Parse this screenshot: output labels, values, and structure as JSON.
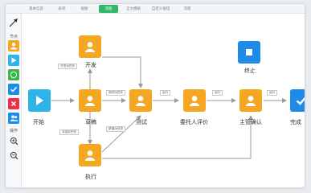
{
  "tabs": [
    "基本信息",
    "表单",
    "视图",
    "流程",
    "正文模板",
    "自定义按钮",
    "流程"
  ],
  "active_tab_index": 3,
  "sidebar": {
    "nodes_label": "节点",
    "ops_label": "操作",
    "tools": [
      "arrow-icon",
      "person-icon",
      "play-icon",
      "wechat-icon",
      "check-icon",
      "close-icon",
      "group-icon",
      "zoom-in-icon",
      "zoom-out-icon"
    ]
  },
  "nodes": {
    "start": "开始",
    "kaifa": "开发",
    "draft": "草稿",
    "test": "测试",
    "exec": "执行",
    "entrust": "委托人评价",
    "manager": "主管确认",
    "end": "终止",
    "complete": "完成"
  },
  "edge_labels": {
    "to_dev": "开发派任务",
    "to_test": "调试派任务",
    "to_exec": "新增派任务",
    "assign": "派给执任务",
    "pass1": "运行",
    "pass2": "运行",
    "pass3": "运行"
  },
  "colors": {
    "accent": "#31b86a",
    "orange": "#f5a623",
    "blue": "#1e8be8",
    "cyan": "#2db4e8"
  }
}
